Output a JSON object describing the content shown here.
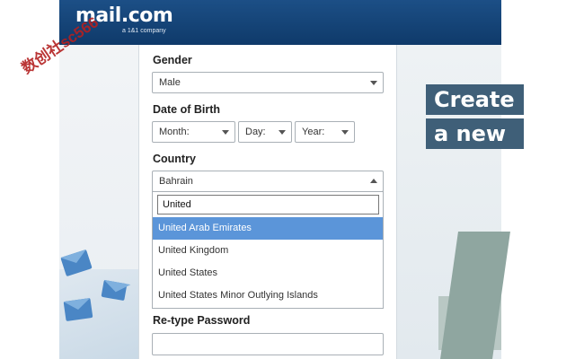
{
  "header": {
    "logo_text": "mail.com",
    "logo_sub": "a 1&1 company"
  },
  "watermark": "数创社sc566",
  "promo": {
    "line1": "Create",
    "line2": "a new"
  },
  "form": {
    "gender": {
      "label": "Gender",
      "value": "Male"
    },
    "dob": {
      "label": "Date of Birth",
      "month": "Month:",
      "day": "Day:",
      "year": "Year:"
    },
    "country": {
      "label": "Country",
      "value": "Bahrain",
      "search_value": "United",
      "options": [
        "United Arab Emirates",
        "United Kingdom",
        "United States",
        "United States Minor Outlying Islands"
      ],
      "highlighted_index": 0
    },
    "retype_password": {
      "label": "Re-type Password"
    }
  },
  "colors": {
    "header": "#0f3a6a",
    "highlight": "#5b95d9",
    "promo_bg": "#3f5f78"
  }
}
